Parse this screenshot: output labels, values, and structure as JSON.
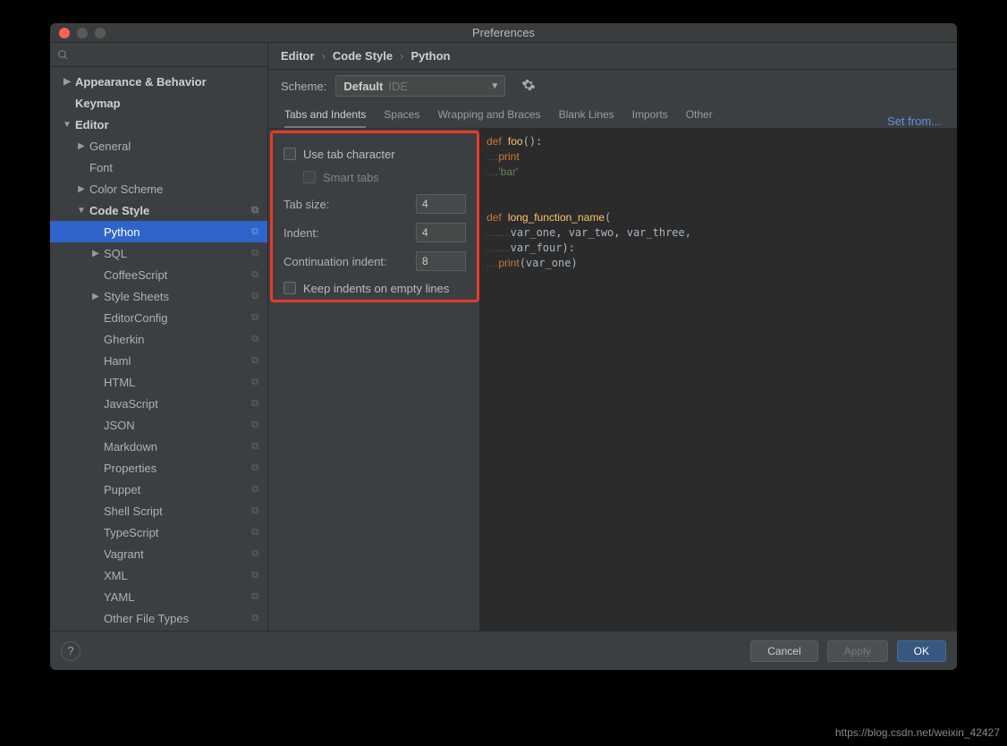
{
  "title": "Preferences",
  "breadcrumb": {
    "a": "Editor",
    "b": "Code Style",
    "c": "Python"
  },
  "scheme": {
    "label": "Scheme:",
    "value": "Default",
    "hint": "IDE"
  },
  "setfrom": "Set from...",
  "sidebar": {
    "items": [
      {
        "label": "Appearance & Behavior",
        "bold": true,
        "tri": "▶",
        "lvl": 0
      },
      {
        "label": "Keymap",
        "bold": true,
        "lvl": 0
      },
      {
        "label": "Editor",
        "bold": true,
        "tri": "▼",
        "lvl": 0
      },
      {
        "label": "General",
        "tri": "▶",
        "lvl": 1
      },
      {
        "label": "Font",
        "lvl": 1
      },
      {
        "label": "Color Scheme",
        "tri": "▶",
        "lvl": 1
      },
      {
        "label": "Code Style",
        "bold": true,
        "tri": "▼",
        "lvl": 1,
        "copy": true
      },
      {
        "label": "Python",
        "lvl": 2,
        "active": true,
        "copy": true
      },
      {
        "label": "SQL",
        "tri": "▶",
        "lvl": 2,
        "copy": true
      },
      {
        "label": "CoffeeScript",
        "lvl": 2,
        "copy": true
      },
      {
        "label": "Style Sheets",
        "tri": "▶",
        "lvl": 2,
        "copy": true
      },
      {
        "label": "EditorConfig",
        "lvl": 2,
        "copy": true
      },
      {
        "label": "Gherkin",
        "lvl": 2,
        "copy": true
      },
      {
        "label": "Haml",
        "lvl": 2,
        "copy": true
      },
      {
        "label": "HTML",
        "lvl": 2,
        "copy": true
      },
      {
        "label": "JavaScript",
        "lvl": 2,
        "copy": true
      },
      {
        "label": "JSON",
        "lvl": 2,
        "copy": true
      },
      {
        "label": "Markdown",
        "lvl": 2,
        "copy": true
      },
      {
        "label": "Properties",
        "lvl": 2,
        "copy": true
      },
      {
        "label": "Puppet",
        "lvl": 2,
        "copy": true
      },
      {
        "label": "Shell Script",
        "lvl": 2,
        "copy": true
      },
      {
        "label": "TypeScript",
        "lvl": 2,
        "copy": true
      },
      {
        "label": "Vagrant",
        "lvl": 2,
        "copy": true
      },
      {
        "label": "XML",
        "lvl": 2,
        "copy": true
      },
      {
        "label": "YAML",
        "lvl": 2,
        "copy": true
      },
      {
        "label": "Other File Types",
        "lvl": 2,
        "copy": true
      }
    ]
  },
  "tabs": [
    "Tabs and Indents",
    "Spaces",
    "Wrapping and Braces",
    "Blank Lines",
    "Imports",
    "Other"
  ],
  "settings": {
    "use_tab": "Use tab character",
    "smart_tabs": "Smart tabs",
    "tab_size_lbl": "Tab size:",
    "tab_size": "4",
    "indent_lbl": "Indent:",
    "indent": "4",
    "cont_lbl": "Continuation indent:",
    "cont": "8",
    "keep_empty": "Keep indents on empty lines"
  },
  "footer": {
    "cancel": "Cancel",
    "apply": "Apply",
    "ok": "OK"
  },
  "watermark": "https://blog.csdn.net/weixin_42427"
}
